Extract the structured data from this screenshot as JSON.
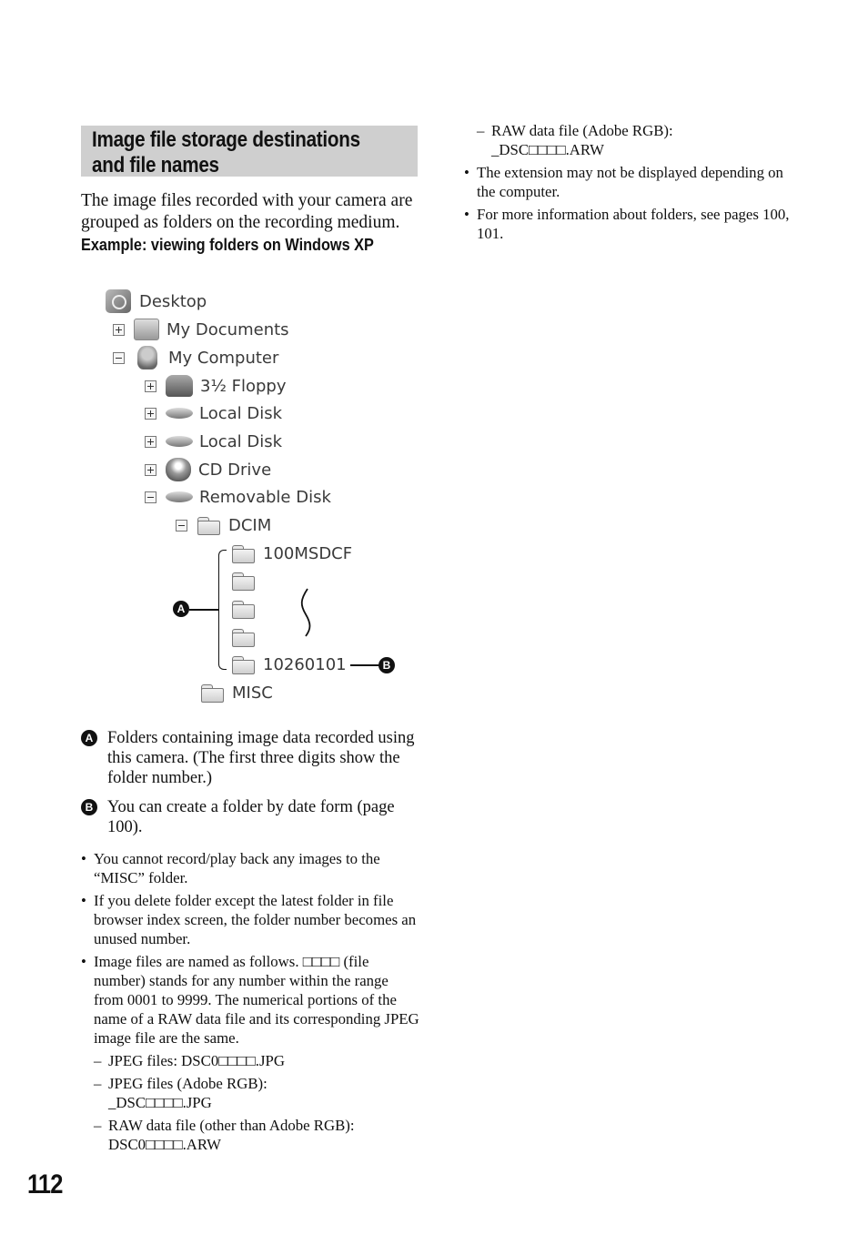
{
  "section": {
    "title_line1": "Image file storage destinations",
    "title_line2": "and file names",
    "intro": "The image files recorded with your camera are grouped as folders on the recording medium.",
    "example_heading": "Example: viewing folders on Windows XP"
  },
  "tree": {
    "desktop": "Desktop",
    "my_documents": "My Documents",
    "my_computer": "My Computer",
    "floppy": "3½ Floppy",
    "local_disk_1": "Local Disk",
    "local_disk_2": "Local Disk",
    "cd_drive": "CD Drive",
    "removable_disk": "Removable Disk",
    "dcim": "DCIM",
    "folder_first": "100MSDCF",
    "folder_last": "10260101",
    "misc": "MISC"
  },
  "callouts": {
    "a_label": "A",
    "b_label": "B",
    "a_text": "Folders containing image data recorded using this camera. (The first three digits show the folder number.)",
    "b_text": "You can create a folder by date form (page 100)."
  },
  "notes": {
    "bullet_symbol": "•",
    "dash_symbol": "–",
    "note1": "You cannot record/play back any images to the “MISC” folder.",
    "note2": "If you delete folder except the latest folder in file browser index screen, the folder number becomes an unused number.",
    "note3": "Image files are named as follows. □□□□ (file number) stands for any number within the range from 0001 to 9999. The numerical portions of the name of a RAW data file and its corresponding JPEG image file are the same.",
    "sub1": "JPEG files: DSC0□□□□.JPG",
    "sub2_a": "JPEG files (Adobe RGB):",
    "sub2_b": "_DSC□□□□.JPG",
    "sub3_a": "RAW data file (other than Adobe RGB):",
    "sub3_b": "DSC0□□□□.ARW",
    "sub4_a": "RAW data file (Adobe RGB):",
    "sub4_b": "_DSC□□□□.ARW",
    "note4": "The extension may not be displayed depending on the computer.",
    "note5": "For more information about folders, see pages 100, 101."
  },
  "page_number": "112"
}
